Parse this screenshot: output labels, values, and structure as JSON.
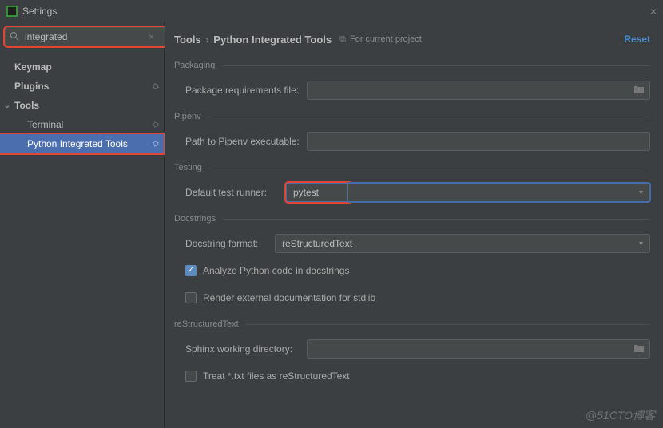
{
  "titlebar": {
    "title": "Settings"
  },
  "sidebar": {
    "search_value": "integrated",
    "items": [
      {
        "label": "Keymap",
        "level": 1,
        "badge": ""
      },
      {
        "label": "Plugins",
        "level": 1,
        "badge": "⛭"
      },
      {
        "label": "Tools",
        "level": 1,
        "badge": "",
        "expanded": true
      },
      {
        "label": "Terminal",
        "level": 2,
        "badge": "⛭"
      },
      {
        "label": "Python Integrated Tools",
        "level": 2,
        "badge": "⛭",
        "selected": true
      }
    ]
  },
  "header": {
    "breadcrumb_root": "Tools",
    "breadcrumb_sep": "›",
    "breadcrumb_leaf": "Python Integrated Tools",
    "project_chip": "For current project",
    "reset": "Reset"
  },
  "sections": {
    "packaging": {
      "title": "Packaging",
      "pkg_req_label": "Package requirements file:",
      "pkg_req_value": ""
    },
    "pipenv": {
      "title": "Pipenv",
      "path_label": "Path to Pipenv executable:",
      "path_value": ""
    },
    "testing": {
      "title": "Testing",
      "runner_label": "Default test runner:",
      "runner_value": "pytest"
    },
    "docstrings": {
      "title": "Docstrings",
      "format_label": "Docstring format:",
      "format_value": "reStructuredText",
      "analyze_label": "Analyze Python code in docstrings",
      "render_label": "Render external documentation for stdlib"
    },
    "rst": {
      "title": "reStructuredText",
      "sphinx_label": "Sphinx working directory:",
      "sphinx_value": "",
      "treat_label": "Treat *.txt files as reStructuredText"
    }
  },
  "watermark": "@51CTO博客"
}
